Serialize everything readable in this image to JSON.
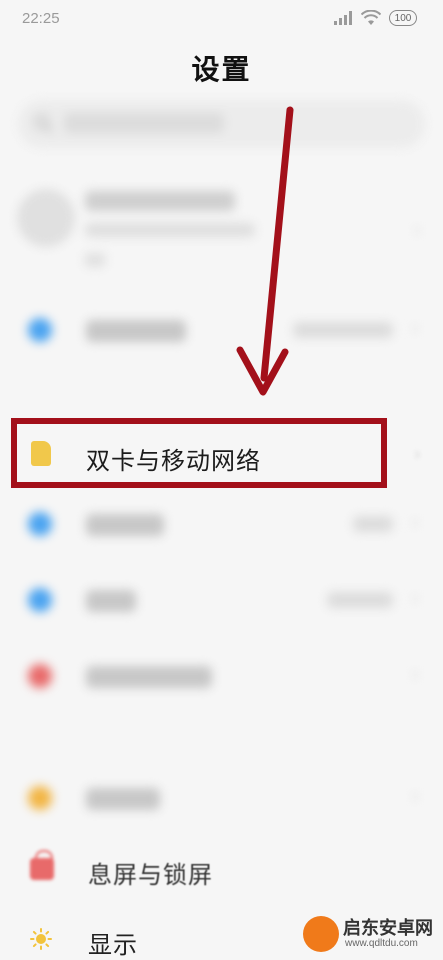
{
  "status_bar": {
    "time": "22:25",
    "battery": "100"
  },
  "header": {
    "title": "设置"
  },
  "highlighted_item": {
    "label": "双卡与移动网络",
    "icon": "sim-card-icon",
    "icon_color": "#f1c84b",
    "highlight_color": "#a3101a"
  },
  "visible_items": [
    {
      "label": "息屏与锁屏",
      "icon": "lock-icon",
      "icon_color": "#e86a6a"
    },
    {
      "label": "显示",
      "icon": "sun-icon",
      "icon_color": "#f2c33c"
    }
  ],
  "annotation": {
    "arrow_color": "#a3101a"
  },
  "watermark": {
    "title": "启东安卓网",
    "url": "www.qdltdu.com"
  }
}
